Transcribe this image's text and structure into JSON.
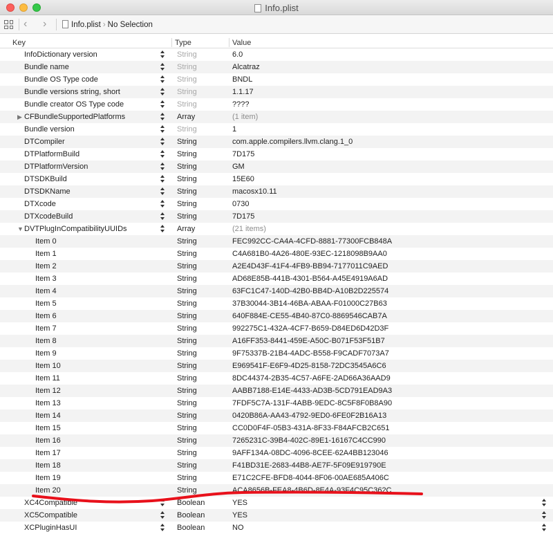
{
  "window": {
    "title": "Info.plist"
  },
  "breadcrumb": {
    "file": "Info.plist",
    "selection": "No Selection"
  },
  "columns": {
    "key": "Key",
    "type": "Type",
    "value": "Value"
  },
  "rows": [
    {
      "key": "InfoDictionary version",
      "type": "String",
      "value": "6.0",
      "indent": 0,
      "stepper": true,
      "dimType": true
    },
    {
      "key": "Bundle name",
      "type": "String",
      "value": "Alcatraz",
      "indent": 0,
      "stepper": true,
      "dimType": true
    },
    {
      "key": "Bundle OS Type code",
      "type": "String",
      "value": "BNDL",
      "indent": 0,
      "stepper": true,
      "dimType": true
    },
    {
      "key": "Bundle versions string, short",
      "type": "String",
      "value": "1.1.17",
      "indent": 0,
      "stepper": true,
      "dimType": true
    },
    {
      "key": "Bundle creator OS Type code",
      "type": "String",
      "value": "????",
      "indent": 0,
      "stepper": true,
      "dimType": true
    },
    {
      "key": "CFBundleSupportedPlatforms",
      "type": "Array",
      "value": "(1 item)",
      "indent": 0,
      "stepper": true,
      "disclosure": "collapsed",
      "dimValue": true
    },
    {
      "key": "Bundle version",
      "type": "String",
      "value": "1",
      "indent": 0,
      "stepper": true,
      "dimType": true
    },
    {
      "key": "DTCompiler",
      "type": "String",
      "value": "com.apple.compilers.llvm.clang.1_0",
      "indent": 0,
      "stepper": true
    },
    {
      "key": "DTPlatformBuild",
      "type": "String",
      "value": "7D175",
      "indent": 0,
      "stepper": true
    },
    {
      "key": "DTPlatformVersion",
      "type": "String",
      "value": "GM",
      "indent": 0,
      "stepper": true
    },
    {
      "key": "DTSDKBuild",
      "type": "String",
      "value": "15E60",
      "indent": 0,
      "stepper": true
    },
    {
      "key": "DTSDKName",
      "type": "String",
      "value": "macosx10.11",
      "indent": 0,
      "stepper": true
    },
    {
      "key": "DTXcode",
      "type": "String",
      "value": "0730",
      "indent": 0,
      "stepper": true
    },
    {
      "key": "DTXcodeBuild",
      "type": "String",
      "value": "7D175",
      "indent": 0,
      "stepper": true
    },
    {
      "key": "DVTPlugInCompatibilityUUIDs",
      "type": "Array",
      "value": "(21 items)",
      "indent": 0,
      "stepper": true,
      "disclosure": "expanded",
      "dimValue": true
    },
    {
      "key": "Item 0",
      "type": "String",
      "value": "FEC992CC-CA4A-4CFD-8881-77300FCB848A",
      "indent": 1
    },
    {
      "key": "Item 1",
      "type": "String",
      "value": "C4A681B0-4A26-480E-93EC-1218098B9AA0",
      "indent": 1
    },
    {
      "key": "Item 2",
      "type": "String",
      "value": "A2E4D43F-41F4-4FB9-BB94-7177011C9AED",
      "indent": 1
    },
    {
      "key": "Item 3",
      "type": "String",
      "value": "AD68E85B-441B-4301-B564-A45E4919A6AD",
      "indent": 1
    },
    {
      "key": "Item 4",
      "type": "String",
      "value": "63FC1C47-140D-42B0-BB4D-A10B2D225574",
      "indent": 1
    },
    {
      "key": "Item 5",
      "type": "String",
      "value": "37B30044-3B14-46BA-ABAA-F01000C27B63",
      "indent": 1
    },
    {
      "key": "Item 6",
      "type": "String",
      "value": "640F884E-CE55-4B40-87C0-8869546CAB7A",
      "indent": 1
    },
    {
      "key": "Item 7",
      "type": "String",
      "value": "992275C1-432A-4CF7-B659-D84ED6D42D3F",
      "indent": 1
    },
    {
      "key": "Item 8",
      "type": "String",
      "value": "A16FF353-8441-459E-A50C-B071F53F51B7",
      "indent": 1
    },
    {
      "key": "Item 9",
      "type": "String",
      "value": "9F75337B-21B4-4ADC-B558-F9CADF7073A7",
      "indent": 1
    },
    {
      "key": "Item 10",
      "type": "String",
      "value": "E969541F-E6F9-4D25-8158-72DC3545A6C6",
      "indent": 1
    },
    {
      "key": "Item 11",
      "type": "String",
      "value": "8DC44374-2B35-4C57-A6FE-2AD66A36AAD9",
      "indent": 1
    },
    {
      "key": "Item 12",
      "type": "String",
      "value": "AABB7188-E14E-4433-AD3B-5CD791EAD9A3",
      "indent": 1
    },
    {
      "key": "Item 13",
      "type": "String",
      "value": "7FDF5C7A-131F-4ABB-9EDC-8C5F8F0B8A90",
      "indent": 1
    },
    {
      "key": "Item 14",
      "type": "String",
      "value": "0420B86A-AA43-4792-9ED0-6FE0F2B16A13",
      "indent": 1
    },
    {
      "key": "Item 15",
      "type": "String",
      "value": "CC0D0F4F-05B3-431A-8F33-F84AFCB2C651",
      "indent": 1
    },
    {
      "key": "Item 16",
      "type": "String",
      "value": "7265231C-39B4-402C-89E1-16167C4CC990",
      "indent": 1
    },
    {
      "key": "Item 17",
      "type": "String",
      "value": "9AFF134A-08DC-4096-8CEE-62A4BB123046",
      "indent": 1
    },
    {
      "key": "Item 18",
      "type": "String",
      "value": "F41BD31E-2683-44B8-AE7F-5F09E919790E",
      "indent": 1
    },
    {
      "key": "Item 19",
      "type": "String",
      "value": "E71C2CFE-BFD8-4044-8F06-00AE685A406C",
      "indent": 1
    },
    {
      "key": "Item 20",
      "type": "String",
      "value": "ACA8656B-FEA8-4B6D-8E4A-93F4C95C362C",
      "indent": 1
    },
    {
      "key": "XC4Compatible",
      "type": "Boolean",
      "value": "YES",
      "indent": 0,
      "stepper": true,
      "valueStepper": true
    },
    {
      "key": "XC5Compatible",
      "type": "Boolean",
      "value": "YES",
      "indent": 0,
      "stepper": true,
      "valueStepper": true
    },
    {
      "key": "XCPluginHasUI",
      "type": "Boolean",
      "value": "NO",
      "indent": 0,
      "stepper": true,
      "valueStepper": true
    }
  ],
  "colors": {
    "annotation": "#e8111b",
    "alt_row": "#f3f3f3"
  }
}
